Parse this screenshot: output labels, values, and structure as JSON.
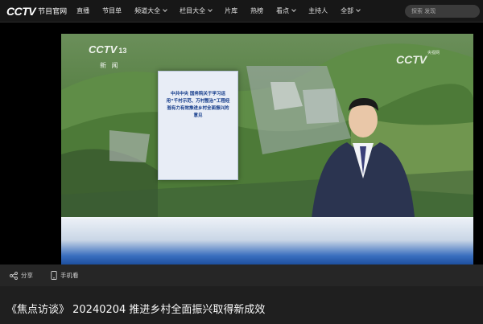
{
  "header": {
    "logo": "CCTV",
    "logo_sub": "节目官网",
    "nav": [
      {
        "label": "直播",
        "dropdown": false
      },
      {
        "label": "节目单",
        "dropdown": false
      },
      {
        "label": "频道大全",
        "dropdown": true
      },
      {
        "label": "栏目大全",
        "dropdown": true
      },
      {
        "label": "片库",
        "dropdown": false
      },
      {
        "label": "热榜",
        "dropdown": false
      },
      {
        "label": "看点",
        "dropdown": true
      },
      {
        "label": "主持人",
        "dropdown": false
      },
      {
        "label": "全部",
        "dropdown": true
      }
    ],
    "search_placeholder": "探索 发现"
  },
  "player": {
    "channel_logo": "CCTV",
    "channel_number": "13",
    "channel_name": "新 闻",
    "watermark_logo": "CCTV",
    "watermark_sub": "央视网",
    "document_text": "中共中央 国务院关于学习运用“千村示范、万村整治”工程经验有力有效推进乡村全面振兴的意见"
  },
  "actions": {
    "share_label": "分享",
    "mobile_label": "手机看"
  },
  "video": {
    "title": "《焦点访谈》 20240204 推进乡村全面振兴取得新成效"
  },
  "colors": {
    "background": "#1f1f1f",
    "header_bg": "#171717",
    "accent_blue": "#1d4f9e"
  }
}
